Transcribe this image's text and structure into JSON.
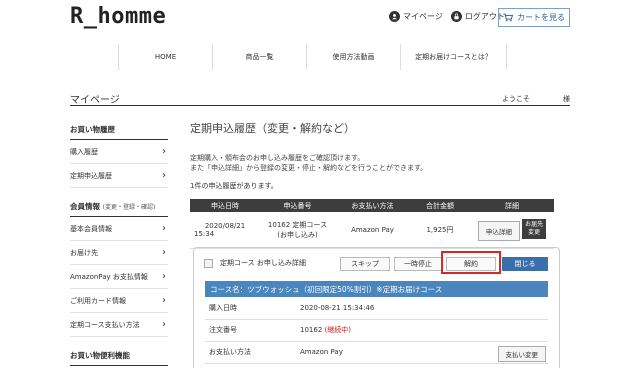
{
  "header": {
    "logo": "R_homme",
    "mypage_link": "マイページ",
    "logout_link": "ログアウト",
    "cart_button": "カートを見る"
  },
  "gnav": [
    "HOME",
    "商品一覧",
    "使用方法動画",
    "定期お届けコースとは？"
  ],
  "mypage": {
    "title": "マイページ",
    "welcome": "ようこそ",
    "suffix": "様"
  },
  "sidebar": {
    "section1": "お買い物履歴",
    "items1": [
      "購入履歴",
      "定期申込履歴"
    ],
    "section2": "会員情報",
    "section2_note": "(変更・登録・確認)",
    "items2": [
      "基本会員情報",
      "お届け先",
      "AmazonPay お支払情報",
      "ご利用カード情報",
      "定期コース支払い方法"
    ],
    "section3": "お買い物便利機能"
  },
  "main": {
    "title": "定期申込履歴（変更・解約など）",
    "desc1": "定期購入・頒布会のお申し込み履歴をご確認頂けます。",
    "desc2": "また「申込詳細」から登録の変更・停止・解約などを行うことができます。",
    "count": "1件の申込履歴があります。"
  },
  "table": {
    "headers": [
      "申込日時",
      "申込番号",
      "お支払い方法",
      "合計金額",
      "詳細"
    ],
    "row": {
      "date": "2020/08/21",
      "time": "15:34",
      "number": "10162 定期コース",
      "status": "(お申し込み)",
      "payment": "Amazon Pay",
      "total": "1,925円",
      "detail_button": "申込詳細",
      "change_button_line1": "お届先",
      "change_button_line2": "変更"
    }
  },
  "detail": {
    "heading": "定期コース お申し込み詳細",
    "skip": "スキップ",
    "pause": "一時停止",
    "cancel": "解約",
    "close": "閉じる",
    "course_name": "コース名：ツブウォッシュ（初回限定50%割引）※定期お届けコース",
    "rows": [
      {
        "key": "購入日時",
        "value": "2020-08-21 15:34:46"
      },
      {
        "key": "注文番号",
        "value": "10162",
        "status": "(継続中)"
      },
      {
        "key": "お支払い方法",
        "value": "Amazon Pay",
        "button": "支払い変更"
      }
    ]
  },
  "colors": {
    "accent": "#3b6fa9",
    "course_bar": "#4a85bd",
    "highlight": "#d62828",
    "table_head": "#3d3d3d"
  }
}
